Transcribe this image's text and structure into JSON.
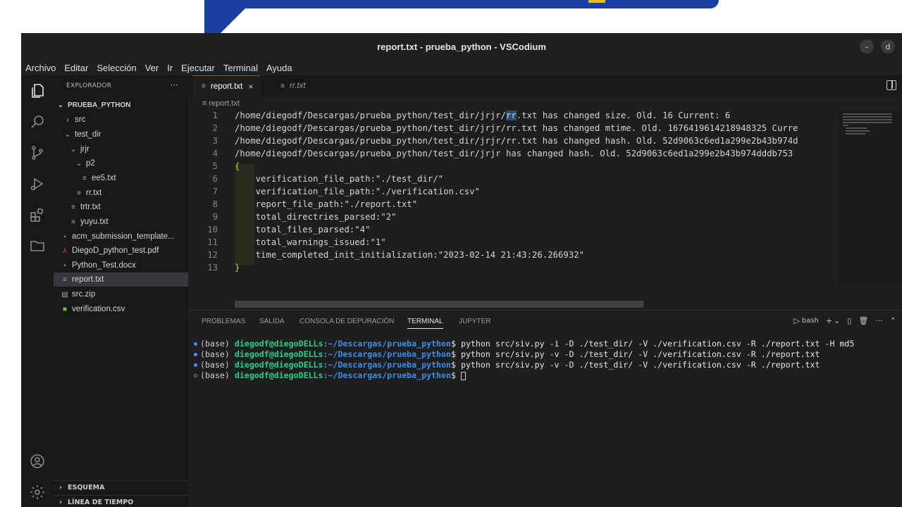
{
  "window": {
    "title": "report.txt - prueba_python - VSCodium",
    "minimize_glyph": "–",
    "close_glyph": "d"
  },
  "menubar": [
    "Archivo",
    "Editar",
    "Selección",
    "Ver",
    "Ir",
    "Ejecutar",
    "Terminal",
    "Ayuda"
  ],
  "activity_bar": {
    "icons": [
      "files-icon",
      "search-icon",
      "source-control-icon",
      "run-debug-icon",
      "extensions-icon",
      "folder-icon"
    ],
    "bottom_icons": [
      "account-icon",
      "settings-gear-icon"
    ]
  },
  "sidebar": {
    "title": "EXPLORADOR",
    "more": "···",
    "root": "PRUEBA_PYTHON",
    "items": [
      {
        "label": "src",
        "depth": 1,
        "kind": "folder",
        "open": false
      },
      {
        "label": "test_dir",
        "depth": 1,
        "kind": "folder",
        "open": true
      },
      {
        "label": "jrjr",
        "depth": 2,
        "kind": "folder",
        "open": true
      },
      {
        "label": "p2",
        "depth": 3,
        "kind": "folder",
        "open": true
      },
      {
        "label": "ee5.txt",
        "depth": 4,
        "kind": "txt"
      },
      {
        "label": "rr.txt",
        "depth": 3,
        "kind": "txt"
      },
      {
        "label": "trtr.txt",
        "depth": 2,
        "kind": "txt"
      },
      {
        "label": "yuyu.txt",
        "depth": 2,
        "kind": "txt"
      },
      {
        "label": "acm_submission_template...",
        "depth": 1,
        "kind": "doc"
      },
      {
        "label": "DiegoD_python_test.pdf",
        "depth": 1,
        "kind": "pdf"
      },
      {
        "label": "Python_Test.docx",
        "depth": 1,
        "kind": "doc"
      },
      {
        "label": "report.txt",
        "depth": 1,
        "kind": "txt",
        "selected": true
      },
      {
        "label": "src.zip",
        "depth": 1,
        "kind": "zip"
      },
      {
        "label": "verification.csv",
        "depth": 1,
        "kind": "csv"
      }
    ],
    "sections": [
      "ESQUEMA",
      "LÍNEA DE TIEMPO"
    ]
  },
  "editor": {
    "tabs": [
      {
        "label": "report.txt",
        "active": true,
        "close": "×"
      },
      {
        "label": "rr.txt",
        "active": false
      }
    ],
    "breadcrumb": "report.txt",
    "lines": [
      {
        "n": "1",
        "pre": "/home/diegodf/Descargas/prueba_python/test_dir/jrjr/",
        "hl": "rr",
        "post": ".txt has changed size. Old. 16 Current: 6"
      },
      {
        "n": "2",
        "pre": "/home/diegodf/Descargas/prueba_python/test_dir/jrjr/rr.txt has changed mtime. Old. 1676419614218948325 Curre",
        "hl": "",
        "post": ""
      },
      {
        "n": "3",
        "pre": "/home/diegodf/Descargas/prueba_python/test_dir/jrjr/rr.txt has changed hash. Old. 52d9063c6ed1a299e2b43b974d",
        "hl": "",
        "post": ""
      },
      {
        "n": "4",
        "pre": "/home/diegodf/Descargas/prueba_python/test_dir/jrjr has changed hash. Old. 52d9063c6ed1a299e2b43b974dddb753",
        "hl": "",
        "post": ""
      },
      {
        "n": "5",
        "pre": "{",
        "hl": "",
        "post": "",
        "brace": true
      },
      {
        "n": "6",
        "pre": "    verification_file_path:\"./test_dir/\"",
        "hl": "",
        "post": ""
      },
      {
        "n": "7",
        "pre": "    verification_file_path:\"./verification.csv\"",
        "hl": "",
        "post": ""
      },
      {
        "n": "8",
        "pre": "    report_file_path:\"./report.txt\"",
        "hl": "",
        "post": ""
      },
      {
        "n": "9",
        "pre": "    total_directries_parsed:\"2\"",
        "hl": "",
        "post": ""
      },
      {
        "n": "10",
        "pre": "    total_files_parsed:\"4\"",
        "hl": "",
        "post": ""
      },
      {
        "n": "11",
        "pre": "    total_warnings_issued:\"1\"",
        "hl": "",
        "post": ""
      },
      {
        "n": "12",
        "pre": "    time_completed_init_initialization:\"2023-02-14 21:43:26.266932\"",
        "hl": "",
        "post": ""
      },
      {
        "n": "13",
        "pre": "}",
        "hl": "",
        "post": "",
        "brace": true
      }
    ]
  },
  "panel": {
    "tabs": [
      "PROBLEMAS",
      "SALIDA",
      "CONSOLA DE DEPURACIÓN",
      "TERMINAL",
      "JUPYTER"
    ],
    "active_tab": "TERMINAL",
    "shell": "bash",
    "tool_glyphs": [
      "+",
      "⌄",
      "▯",
      "🗑",
      "···",
      "⌃"
    ],
    "terminal_lines": [
      {
        "status": "blue",
        "base": "(base) ",
        "user": "diegodf@diegoDELLs",
        "path": ":~/Descargas/prueba_python",
        "cmd": "$ python src/siv.py -i -D ./test_dir/ -V ./verification.csv -R ./report.txt -H md5"
      },
      {
        "status": "blue",
        "base": "(base) ",
        "user": "diegodf@diegoDELLs",
        "path": ":~/Descargas/prueba_python",
        "cmd": "$ python src/siv.py -v -D ./test_dir/ -V ./verification.csv -R ./report.txt"
      },
      {
        "status": "blue",
        "base": "(base) ",
        "user": "diegodf@diegoDELLs",
        "path": ":~/Descargas/prueba_python",
        "cmd": "$ python src/siv.py -v -D ./test_dir/ -V ./verification.csv -R ./report.txt"
      },
      {
        "status": "hollow",
        "base": "(base) ",
        "user": "diegodf@diegoDELLs",
        "path": ":~/Descargas/prueba_python",
        "cmd": "$ ",
        "cursor": true
      }
    ]
  },
  "colors": {
    "accent": "#0078d4",
    "banner": "#1a3fa0",
    "terminal_user": "#23d18b",
    "terminal_path": "#3b8eea"
  }
}
